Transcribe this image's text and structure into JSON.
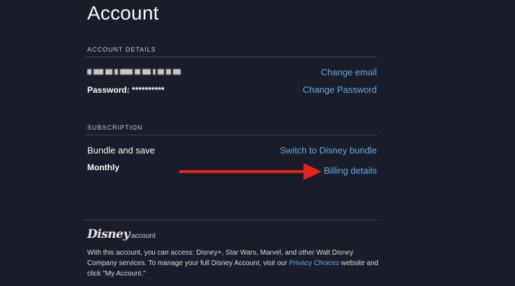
{
  "page": {
    "title": "Account"
  },
  "account_details": {
    "section_label": "ACCOUNT DETAILS",
    "password_label": "Password:",
    "password_value": "**********",
    "change_email_label": "Change email",
    "change_password_label": "Change Password"
  },
  "subscription": {
    "section_label": "SUBSCRIPTION",
    "plan_name": "Bundle and save",
    "billing_cycle": "Monthly",
    "switch_bundle_label": "Switch to Disney bundle",
    "billing_details_label": "Billing details"
  },
  "footer": {
    "logo_brand": "Disney",
    "logo_suffix": "account",
    "text_part1": "With this account, you can access: Disney+, Star Wars, Marvel, and other Walt Disney Company services. To manage your full Disney Account, visit our ",
    "privacy_link": "Privacy Choices",
    "text_part2": " website and click \"My Account.\""
  },
  "colors": {
    "background": "#1a1d29",
    "link": "#67a7e8",
    "arrow": "#e8231a",
    "divider": "#3c3f4c"
  }
}
